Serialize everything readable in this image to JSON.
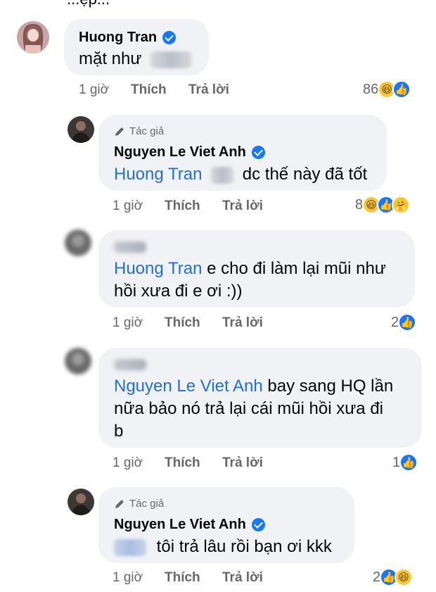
{
  "top_cut_text": "...ệp...",
  "comments": [
    {
      "name": "Huong Tran",
      "text": "mặt như",
      "time": "1 giờ",
      "like": "Thích",
      "reply": "Trả lời",
      "react_count": "86",
      "reactions": [
        "haha-icon",
        "like-icon"
      ]
    },
    {
      "author_tag": "Tác giả",
      "name": "Nguyen Le Viet Anh",
      "mention": "Huong Tran",
      "text": "dc thế này đã tốt",
      "time": "1 giờ",
      "like": "Thích",
      "reply": "Trả lời",
      "react_count": "8",
      "reactions": [
        "haha-icon",
        "like-icon",
        "care-icon"
      ]
    },
    {
      "mention": "Huong Tran",
      "text_line1": "e cho đi làm lại mũi như",
      "text_line2": "hồi xưa đi e ơi :))",
      "time": "1 giờ",
      "like": "Thích",
      "reply": "Trả lời",
      "react_count": "2",
      "reactions": [
        "like-icon"
      ]
    },
    {
      "mention": "Nguyen Le Viet Anh",
      "text_line1": "bay sang HQ lần",
      "text_line2": "nữa bảo nó trả lại cái mũi hồi xưa đi",
      "text_line3": "b",
      "time": "1 giờ",
      "like": "Thích",
      "reply": "Trả lời",
      "react_count": "1",
      "reactions": [
        "like-icon"
      ]
    },
    {
      "author_tag": "Tác giả",
      "name": "Nguyen Le Viet Anh",
      "text": "tôi trả lâu rồi bạn ơi kkk",
      "time": "1 giờ",
      "like": "Thích",
      "reply": "Trả lời",
      "react_count": "2",
      "reactions": [
        "like-icon",
        "haha-icon"
      ]
    }
  ],
  "colors": {
    "bubble": "#f0f2f5",
    "mention": "#216fdb",
    "verified": "#1877f2",
    "meta": "#65676b"
  }
}
